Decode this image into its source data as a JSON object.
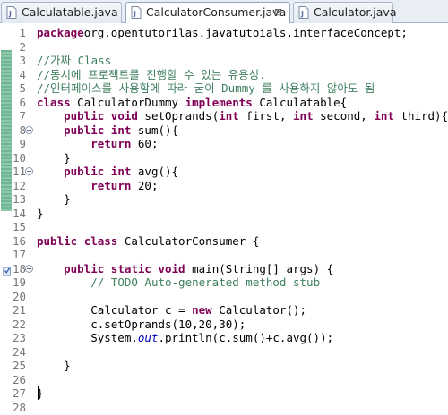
{
  "tabs": [
    {
      "label": "Calculatable.java",
      "active": false
    },
    {
      "label": "CalculatorConsumer.java",
      "active": true,
      "close": "⊠"
    },
    {
      "label": "Calculator.java",
      "active": false
    }
  ],
  "editor": {
    "lines": [
      {
        "n": "1",
        "segs": [
          [
            "kw",
            "package"
          ],
          [
            "",
            "org.opentutorilas.javatutoials.interfaceConcept;"
          ]
        ]
      },
      {
        "n": "2",
        "segs": []
      },
      {
        "n": "3",
        "segs": [
          [
            "cm",
            "//가짜 Class"
          ]
        ]
      },
      {
        "n": "4",
        "segs": [
          [
            "cm",
            "//동시에 프로젝트를 진행할 수 있는 유용성."
          ]
        ]
      },
      {
        "n": "5",
        "segs": [
          [
            "cm",
            "//인터페이스를 사용함에 따라 굳이 Dummy 를 사용하지 않아도 됨"
          ]
        ]
      },
      {
        "n": "6",
        "segs": [
          [
            "kw",
            "class"
          ],
          [
            "",
            " CalculatorDummy "
          ],
          [
            "kw",
            "implements"
          ],
          [
            "",
            " Calculatable{"
          ]
        ]
      },
      {
        "n": "7",
        "segs": [
          [
            "",
            "    "
          ],
          [
            "kw",
            "public"
          ],
          [
            "",
            " "
          ],
          [
            "kw",
            "void"
          ],
          [
            "",
            " setOprands("
          ],
          [
            "kw",
            "int"
          ],
          [
            "",
            " first, "
          ],
          [
            "kw",
            "int"
          ],
          [
            "",
            " second, "
          ],
          [
            "kw",
            "int"
          ],
          [
            "",
            " third){}"
          ]
        ]
      },
      {
        "n": "8",
        "fold": true,
        "segs": [
          [
            "",
            "    "
          ],
          [
            "kw",
            "public"
          ],
          [
            "",
            " "
          ],
          [
            "kw",
            "int"
          ],
          [
            "",
            " sum(){"
          ]
        ]
      },
      {
        "n": "9",
        "segs": [
          [
            "",
            "        "
          ],
          [
            "kw",
            "return"
          ],
          [
            "",
            " 60;"
          ]
        ]
      },
      {
        "n": "10",
        "segs": [
          [
            "",
            "    }"
          ]
        ]
      },
      {
        "n": "11",
        "fold": true,
        "segs": [
          [
            "",
            "    "
          ],
          [
            "kw",
            "public"
          ],
          [
            "",
            " "
          ],
          [
            "kw",
            "int"
          ],
          [
            "",
            " avg(){"
          ]
        ]
      },
      {
        "n": "12",
        "segs": [
          [
            "",
            "        "
          ],
          [
            "kw",
            "return"
          ],
          [
            "",
            " 20;"
          ]
        ]
      },
      {
        "n": "13",
        "segs": [
          [
            "",
            "    }"
          ]
        ]
      },
      {
        "n": "14",
        "segs": [
          [
            "",
            "}"
          ]
        ]
      },
      {
        "n": "15",
        "segs": []
      },
      {
        "n": "16",
        "segs": [
          [
            "kw",
            "public"
          ],
          [
            "",
            " "
          ],
          [
            "kw",
            "class"
          ],
          [
            "",
            " CalculatorConsumer {"
          ]
        ]
      },
      {
        "n": "17",
        "segs": []
      },
      {
        "n": "18",
        "fold": true,
        "segs": [
          [
            "",
            "    "
          ],
          [
            "kw",
            "public"
          ],
          [
            "",
            " "
          ],
          [
            "kw",
            "static"
          ],
          [
            "",
            " "
          ],
          [
            "kw",
            "void"
          ],
          [
            "",
            " main(String[] args) {"
          ]
        ]
      },
      {
        "n": "19",
        "segs": [
          [
            "",
            "        "
          ],
          [
            "cm",
            "// TODO Auto-generated method stub"
          ]
        ]
      },
      {
        "n": "20",
        "segs": []
      },
      {
        "n": "21",
        "segs": [
          [
            "",
            "        Calculator c = "
          ],
          [
            "kw",
            "new"
          ],
          [
            "",
            " Calculator();"
          ]
        ]
      },
      {
        "n": "22",
        "segs": [
          [
            "",
            "        c.setOprands(10,20,30);"
          ]
        ]
      },
      {
        "n": "23",
        "segs": [
          [
            "",
            "        System."
          ],
          [
            "fld",
            "out"
          ],
          [
            "",
            ".println(c.sum()+c.avg());"
          ]
        ]
      },
      {
        "n": "24",
        "segs": []
      },
      {
        "n": "25",
        "segs": [
          [
            "",
            "    }"
          ]
        ]
      },
      {
        "n": "26",
        "segs": []
      },
      {
        "n": "27",
        "segs": [
          [
            "",
            "}"
          ]
        ]
      },
      {
        "n": "28",
        "segs": []
      }
    ]
  }
}
